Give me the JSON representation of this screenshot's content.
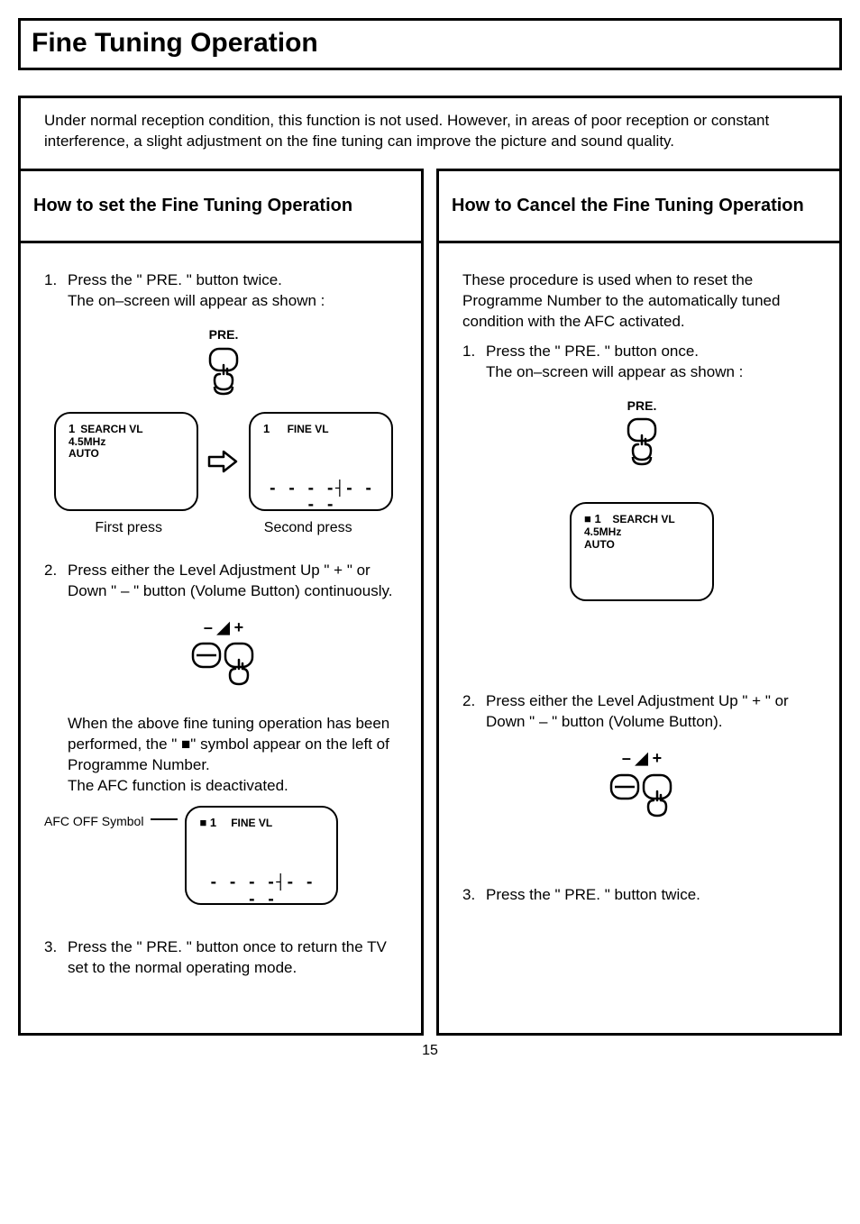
{
  "title": "Fine Tuning Operation",
  "intro": "Under normal reception condition, this function is not used. However, in areas of poor reception or constant interference, a slight adjustment on the fine tuning can improve the picture and sound quality.",
  "left": {
    "heading": "How to set the Fine Tuning Operation",
    "step1_num": "1.",
    "step1_a": "Press the \" PRE. \" button twice.",
    "step1_b": "The on–screen will appear as shown :",
    "pre_label": "PRE.",
    "screen1_line1_a": "1",
    "screen1_line1_b": "SEARCH VL",
    "screen1_line2": "4.5MHz",
    "screen1_line3": "AUTO",
    "screen2_line1_a": "1",
    "screen2_line1_b": "FINE VL",
    "caption1": "First press",
    "caption2": "Second  press",
    "step2_num": "2.",
    "step2_a": "Press either the Level Adjustment Up \" + \" or   Down \" – \" button (Volume Button) continuously.",
    "vol_label": "– ◢ +",
    "note": "When the above fine tuning operation has been performed, the \" ■\" symbol appear on the left of Programme Number.\nThe AFC function is deactivated.",
    "afc_label": "AFC OFF Symbol",
    "screen3_line1_a": "■ 1",
    "screen3_line1_b": "FINE VL",
    "step3_num": "3.",
    "step3": "Press the \" PRE. \" button once to return the TV  set to the normal operating mode."
  },
  "right": {
    "heading": "How to Cancel the Fine Tuning Operation",
    "intro": "These procedure is used  when to reset the Programme Number to the automatically tuned condition with the AFC activated.",
    "step1_num": "1.",
    "step1_a": "Press the \" PRE. \" button once.",
    "step1_b": "The on–screen will appear as shown :",
    "pre_label": "PRE.",
    "screen1_line1_a": "■ 1",
    "screen1_line1_b": "SEARCH VL",
    "screen1_line2": "4.5MHz",
    "screen1_line3": "AUTO",
    "step2_num": "2.",
    "step2": "Press either the Level Adjustment Up \" + \" or Down \" – \" button (Volume Button).",
    "vol_label": "– ◢ +",
    "step3_num": "3.",
    "step3": "Press the \" PRE. \" button twice."
  },
  "page_number": "15"
}
